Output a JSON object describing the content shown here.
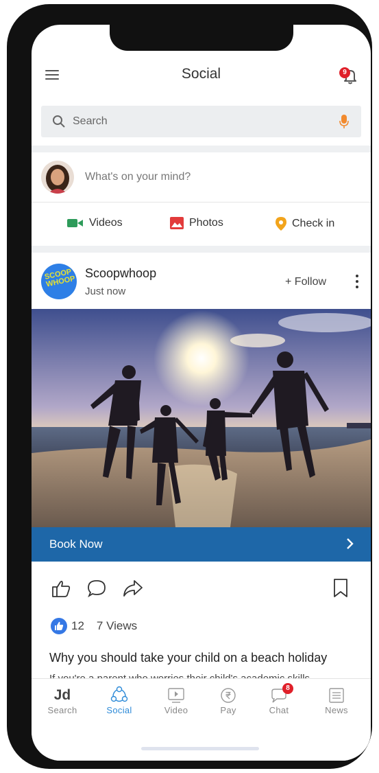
{
  "header": {
    "title": "Social",
    "notification_count": "9"
  },
  "search": {
    "placeholder": "Search"
  },
  "composer": {
    "prompt": "What's on your mind?"
  },
  "actions": [
    {
      "label": "Videos",
      "icon": "video-icon",
      "color": "#2e9b5a"
    },
    {
      "label": "Photos",
      "icon": "photos-icon",
      "color": "#e23b3b"
    },
    {
      "label": "Check in",
      "icon": "location-pin-icon",
      "color": "#f2a41c"
    }
  ],
  "post": {
    "author": "Scoopwhoop",
    "logo_text": "SCOOP WHOOP",
    "time": "Just now",
    "follow_label": "+ Follow",
    "cta_label": "Book Now",
    "like_count": "12",
    "views": "7 Views",
    "headline": "Why you should take your child on a beach holiday",
    "snippet": "If you're a parent who worries their child's academic skills"
  },
  "tabbar": {
    "items": [
      {
        "label": "Search",
        "icon": "jd-logo"
      },
      {
        "label": "Social",
        "icon": "social-icon",
        "active": true
      },
      {
        "label": "Video",
        "icon": "video-play-icon"
      },
      {
        "label": "Pay",
        "icon": "rupee-icon"
      },
      {
        "label": "Chat",
        "icon": "chat-icon",
        "badge": "8"
      },
      {
        "label": "News",
        "icon": "news-icon"
      }
    ],
    "jd_text": "Jd"
  },
  "colors": {
    "accent": "#2e8bd8",
    "cta_bar": "#1e67a8",
    "badge": "#e0202a"
  }
}
